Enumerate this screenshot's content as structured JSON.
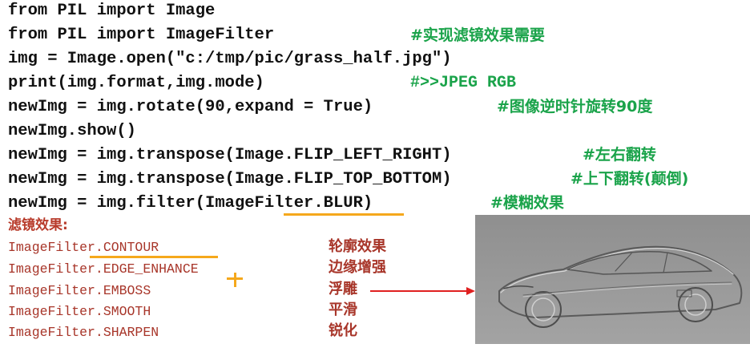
{
  "code_lines": [
    "from PIL import Image",
    "from PIL import ImageFilter",
    "img = Image.open(\"c:/tmp/pic/grass_half.jpg\")",
    "print(img.format,img.mode)",
    "newImg = img.rotate(90,expand = True)",
    "newImg.show()",
    "newImg = img.transpose(Image.FLIP_LEFT_RIGHT)",
    "newImg = img.transpose(Image.FLIP_TOP_BOTTOM)",
    "newImg = img.filter(ImageFilter.BLUR)"
  ],
  "comments": {
    "import_filter": "#实现滤镜效果需要",
    "print_output": "#>>JPEG RGB",
    "rotate": "#图像逆时针旋转90度",
    "flip_lr": "#左右翻转",
    "flip_tb": "#上下翻转(颠倒)",
    "blur": "#模糊效果"
  },
  "section_title": "滤镜效果:",
  "filters": [
    {
      "name": "ImageFilter.CONTOUR",
      "effect": "轮廓效果"
    },
    {
      "name": "ImageFilter.EDGE_ENHANCE",
      "effect": "边缘增强"
    },
    {
      "name": "ImageFilter.EMBOSS",
      "effect": "浮雕"
    },
    {
      "name": "ImageFilter.SMOOTH",
      "effect": "平滑"
    },
    {
      "name": "ImageFilter.SHARPEN",
      "effect": "锐化"
    }
  ],
  "colors": {
    "code": "#111111",
    "comment": "#1aa34a",
    "filter_text": "#a8362a",
    "highlight": "#f5a81c",
    "arrow": "#e02020"
  },
  "image": {
    "subject": "embossed-car-photo"
  }
}
